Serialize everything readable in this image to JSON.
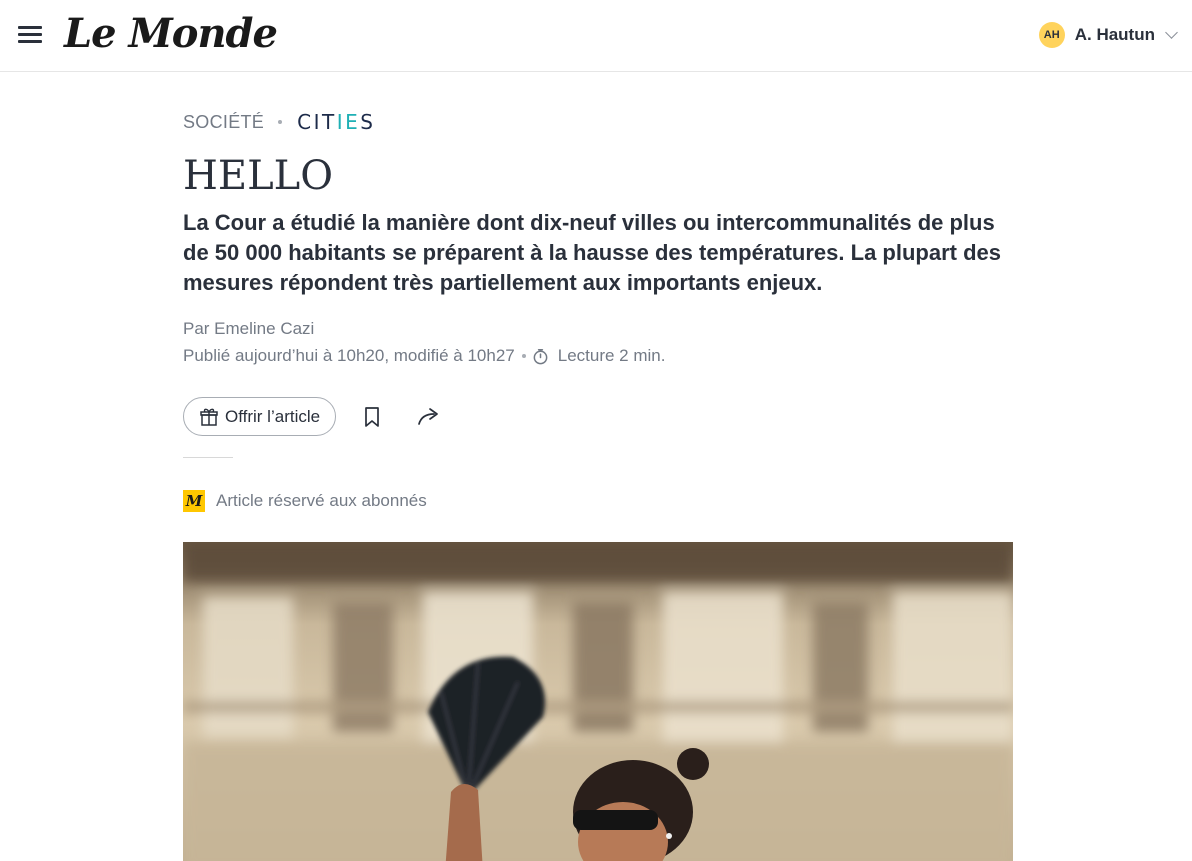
{
  "header": {
    "logo": "Le Monde",
    "user": {
      "initials": "AH",
      "name": "A. Hautun"
    }
  },
  "article": {
    "section": "SOCIÉTÉ",
    "partner_logo": {
      "part1": "CIT",
      "part2": "I",
      "part3": "E",
      "part4": "S"
    },
    "title": "HELLO",
    "lede": "La Cour a étudié la manière dont dix-neuf villes ou intercommunalités de plus de 50 000 habitants se préparent à la hausse des températures. La plupart des mesures répondent très partiellement aux importants enjeux.",
    "author": "Par Emeline Cazi",
    "published": "Publié aujourd’hui à 10h20, modifié à 10h27",
    "reading_time": "Lecture 2 min.",
    "gift_label": "Offrir l’article",
    "premium_label": "Article réservé aux abonnés",
    "premium_badge": "M"
  },
  "colors": {
    "accent_yellow": "#ffc700",
    "avatar_bg": "#ffd35c",
    "text_dark": "#2a303b",
    "text_muted": "#737a85",
    "cities_teal": "#1fb0b5"
  },
  "icons": [
    "menu-icon",
    "chevron-down-icon",
    "timer-icon",
    "gift-icon",
    "bookmark-icon",
    "share-icon"
  ]
}
